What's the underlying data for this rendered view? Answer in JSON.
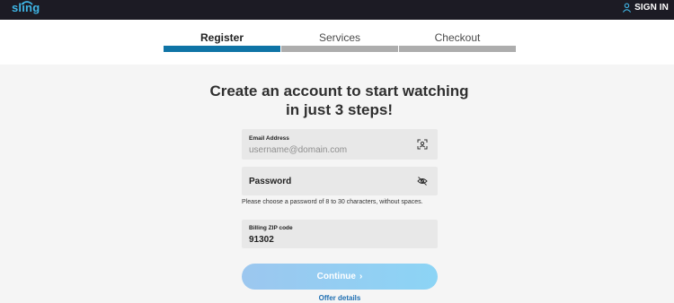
{
  "header": {
    "logo_text": "sling",
    "signin_label": "SIGN IN",
    "brand_color": "#3fb6e6"
  },
  "steps": [
    {
      "label": "Register",
      "active": true
    },
    {
      "label": "Services",
      "active": false
    },
    {
      "label": "Checkout",
      "active": false
    }
  ],
  "form": {
    "headline": "Create an account to start watching in just 3 steps!",
    "email": {
      "label": "Email Address",
      "placeholder": "username@domain.com",
      "icon": "contact-card-icon"
    },
    "password": {
      "label": "Password",
      "icon": "eye-slash-icon"
    },
    "password_hint": "Please choose a password of 8 to 30 characters, without spaces.",
    "zip": {
      "label": "Billing ZIP code",
      "value": "91302"
    },
    "continue_label": "Continue",
    "offer_link": "Offer details"
  },
  "colors": {
    "active_step": "#0f74a6",
    "inactive_step": "#adadad",
    "link": "#1f6fb2"
  }
}
